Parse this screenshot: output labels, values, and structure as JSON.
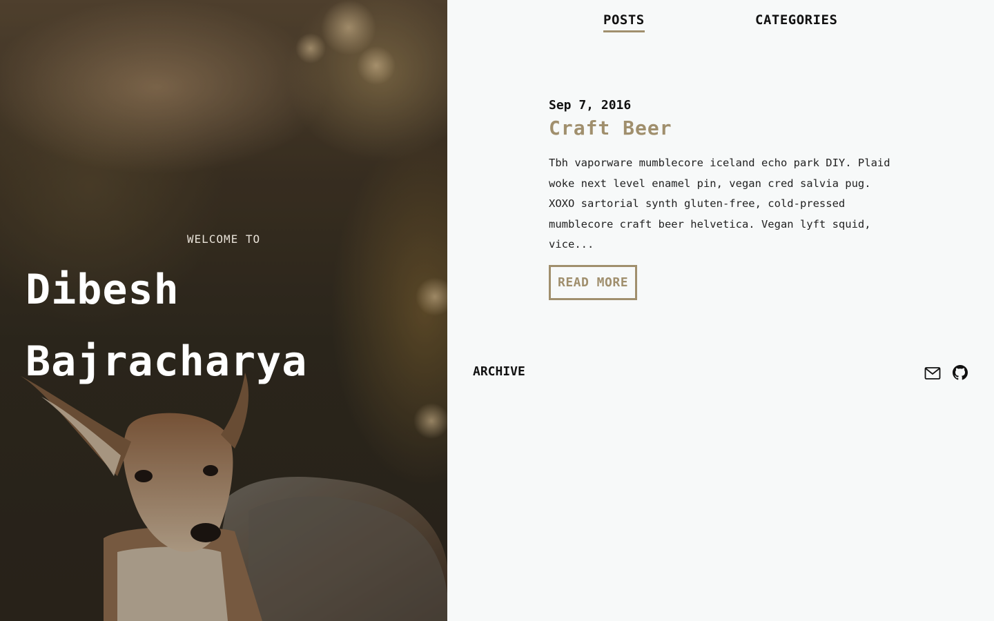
{
  "hero": {
    "welcome": "WELCOME TO",
    "title_line1": "Dibesh",
    "title_line2": "Bajracharya"
  },
  "nav": {
    "items": [
      {
        "label": "POSTS",
        "active": true
      },
      {
        "label": "CATEGORIES",
        "active": false
      }
    ]
  },
  "post": {
    "date": "Sep 7, 2016",
    "title": "Craft Beer",
    "excerpt": "Tbh vaporware mumblecore iceland echo park DIY. Plaid woke next level enamel pin, vegan cred salvia pug. XOXO sartorial synth gluten-free, cold-pressed mumblecore craft beer helvetica. Vegan lyft squid, vice...",
    "read_more": "READ MORE"
  },
  "footer": {
    "archive": "ARCHIVE",
    "icons": [
      "mail-icon",
      "github-icon"
    ]
  },
  "colors": {
    "accent": "#a08f6d",
    "background": "#f7f9f9",
    "text": "#111111"
  }
}
